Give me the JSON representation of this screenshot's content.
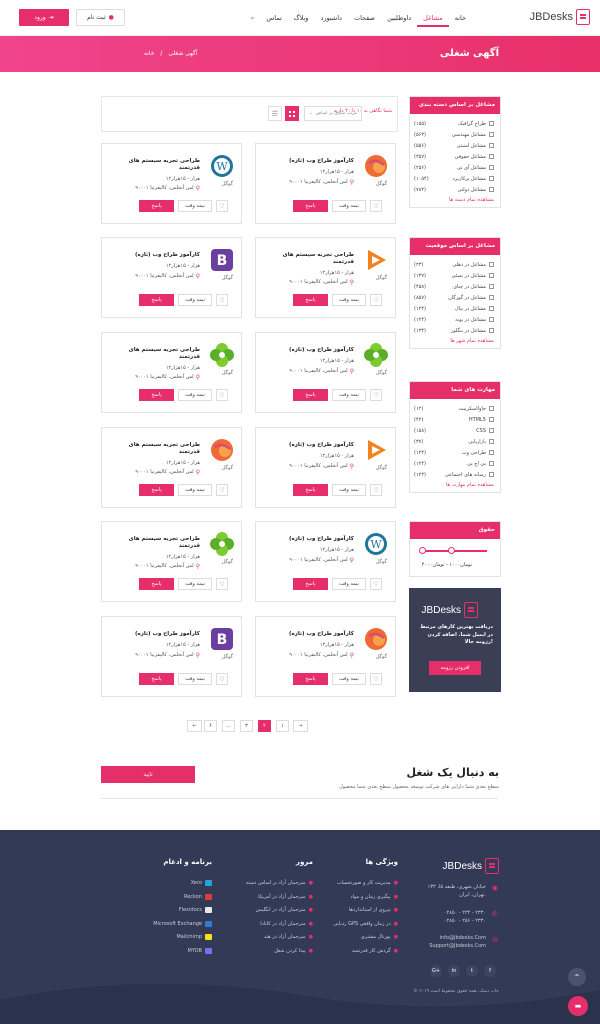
{
  "header": {
    "logo": "JBDesks",
    "nav": [
      "خانه",
      "مشاغل",
      "داوطلبین",
      "صفحات",
      "داشبورد",
      "وبلاگ",
      "تماس"
    ],
    "active_nav": "مشاغل",
    "signup": "ثبت نام",
    "login": "ورود"
  },
  "hero": {
    "title": "آگهی شغلی",
    "breadcrumb_home": "خانه",
    "breadcrumb_sep": "/",
    "breadcrumb_current": "آگهی شغلی"
  },
  "toolbar": {
    "sort_placeholder": "مرتب سازی بر اساس",
    "results": "شما نگاهی به ۱۰ تا ۲۰ دارید"
  },
  "sidebar": {
    "categories": {
      "title": "مشاغل بر اساس دسته بندی",
      "items": [
        {
          "label": "طراح گرافیک",
          "count": "(۱۵۵)"
        },
        {
          "label": "مشاغل مهندسی",
          "count": "(۵۶۳)"
        },
        {
          "label": "مشاغل امنیتی",
          "count": "(۵۵۶)"
        },
        {
          "label": "مشاغل حقوقی",
          "count": "(۳۵۷)"
        },
        {
          "label": "مشاغل آی تی",
          "count": "(۲۵۶)"
        },
        {
          "label": "مشاغل پرکاربرد",
          "count": "(۱۰۵۴)"
        },
        {
          "label": "مشاغل دولتی",
          "count": "(۷۸۴)"
        }
      ],
      "more": "مشاهده تمام دسته ها"
    },
    "locations": {
      "title": "مشاغل بر اساس موقعیت",
      "items": [
        {
          "label": "مشاغل در دهلی",
          "count": "(۲۳)"
        },
        {
          "label": "مشاغل در بمبئی",
          "count": "(۱۳۷)"
        },
        {
          "label": "مشاغل در چنای",
          "count": "(۴۵۸)"
        },
        {
          "label": "مشاغل در گورگان",
          "count": "(۸۵۷)"
        },
        {
          "label": "مشاغل در نپال",
          "count": "(۱۲۴)"
        },
        {
          "label": "مشاغل در پونه",
          "count": "(۱۲۴)"
        },
        {
          "label": "مشاغل در بنگلور",
          "count": "(۱۳۴)"
        }
      ],
      "more": "مشاهده تمام شهر ها"
    },
    "skills": {
      "title": "مهارت های شما",
      "items": [
        {
          "label": "جاوااسکریپت",
          "count": "(۱۲)"
        },
        {
          "label": "HTML5",
          "count": "(۴۲)"
        },
        {
          "label": "CSS",
          "count": "(۱۵۸)"
        },
        {
          "label": "بازاریابی",
          "count": "(۳۷)"
        },
        {
          "label": "طراحی وب",
          "count": "(۱۲۴)"
        },
        {
          "label": "بی اچ پی",
          "count": "(۱۲۴)"
        },
        {
          "label": "رسانه های اجتماعی",
          "count": "(۱۲۴)"
        }
      ],
      "more": "مشاهده تمام مهارت ها"
    },
    "salary": {
      "title": "حقوق",
      "range": "تومان۱۰۰۰ - تومان۴۰۰۰"
    },
    "promo": {
      "logo": "JBDesks",
      "text": "دریافت بهترین کارهای مرتبط در ایمیل شما. اضافه کردن رزومه حالا!",
      "button": "افزودن رزومه"
    }
  },
  "jobs": [
    {
      "title": "کارآموز طراح وب (تازه)",
      "company": "گوگل",
      "salary": "۱۲هزار - ۱۵هزار",
      "location": "لس آنجلس، کالیفرنیا ۹۰۰۰۱",
      "apply": "پاسخ",
      "type": "نیمه وقت",
      "logo": "dribbble",
      "color": "#ee6b35"
    },
    {
      "title": "طراحی تجربه سیستم های قدرتمند",
      "company": "گوگل",
      "salary": "۱۲هزار - ۱۵هزار",
      "location": "لس آنجلس، کالیفرنیا ۹۰۰۰۱",
      "apply": "پاسخ",
      "type": "نیمه وقت",
      "logo": "wordpress",
      "color": "#21759b"
    },
    {
      "title": "طراحی تجربه سیستم های قدرتمند",
      "company": "گوگل",
      "salary": "۱۲هزار - ۱۵هزار",
      "location": "لس آنجلس، کالیفرنیا ۹۰۰۰۱",
      "apply": "پاسخ",
      "type": "نیمه وقت",
      "logo": "play",
      "color": "#f3821f"
    },
    {
      "title": "کارآموز طراح وب (تازه)",
      "company": "گوگل",
      "salary": "۱۲هزار - ۱۵هزار",
      "location": "لس آنجلس، کالیفرنیا ۹۰۰۰۱",
      "apply": "پاسخ",
      "type": "نیمه وقت",
      "logo": "bootstrap",
      "color": "#6b3fa0"
    },
    {
      "title": "کارآموز طراح وب (تازه)",
      "company": "گوگل",
      "salary": "۱۲هزار - ۱۵هزار",
      "location": "لس آنجلس، کالیفرنیا ۹۰۰۰۱",
      "apply": "پاسخ",
      "type": "نیمه وقت",
      "logo": "flower",
      "color": "#7ccb2f"
    },
    {
      "title": "طراحی تجربه سیستم های قدرتمند",
      "company": "گوگل",
      "salary": "۱۲هزار - ۱۵هزار",
      "location": "لس آنجلس، کالیفرنیا ۹۰۰۰۱",
      "apply": "پاسخ",
      "type": "نیمه وقت",
      "logo": "flower",
      "color": "#7ccb2f"
    },
    {
      "title": "کارآموز طراح وب (تازه)",
      "company": "گوگل",
      "salary": "۱۲هزار - ۱۵هزار",
      "location": "لس آنجلس، کالیفرنیا ۹۰۰۰۱",
      "apply": "پاسخ",
      "type": "نیمه وقت",
      "logo": "play",
      "color": "#f3821f"
    },
    {
      "title": "طراحی تجربه سیستم های قدرتمند",
      "company": "گوگل",
      "salary": "۱۲هزار - ۱۵هزار",
      "location": "لس آنجلس، کالیفرنیا ۹۰۰۰۱",
      "apply": "پاسخ",
      "type": "نیمه وقت",
      "logo": "dribbble",
      "color": "#ee6b35"
    },
    {
      "title": "کارآموز طراح وب (تازه)",
      "company": "گوگل",
      "salary": "۱۲هزار - ۱۵هزار",
      "location": "لس آنجلس، کالیفرنیا ۹۰۰۰۱",
      "apply": "پاسخ",
      "type": "نیمه وقت",
      "logo": "wordpress",
      "color": "#21759b"
    },
    {
      "title": "طراحی تجربه سیستم های قدرتمند",
      "company": "گوگل",
      "salary": "۱۲هزار - ۱۵هزار",
      "location": "لس آنجلس، کالیفرنیا ۹۰۰۰۱",
      "apply": "پاسخ",
      "type": "نیمه وقت",
      "logo": "flower",
      "color": "#7ccb2f"
    },
    {
      "title": "کارآموز طراح وب (تازه)",
      "company": "گوگل",
      "salary": "۱۲هزار - ۱۵هزار",
      "location": "لس آنجلس، کالیفرنیا ۹۰۰۰۱",
      "apply": "پاسخ",
      "type": "نیمه وقت",
      "logo": "dribbble",
      "color": "#ee6b35"
    },
    {
      "title": "کارآموز طراح وب (تازه)",
      "company": "گوگل",
      "salary": "۱۲هزار - ۱۵هزار",
      "location": "لس آنجلس، کالیفرنیا ۹۰۰۰۱",
      "apply": "پاسخ",
      "type": "نیمه وقت",
      "logo": "bootstrap",
      "color": "#6b3fa0"
    }
  ],
  "pagination": {
    "next": "→",
    "prev": "←",
    "pages": [
      "۱",
      "۲",
      "۳",
      "...",
      "۶"
    ],
    "active": "۲"
  },
  "cta": {
    "title": "به دنبال یک شغل",
    "text": "سطح بعدی شما دارایی های شرکت توسعه محصول سطح بعدی شما محصول",
    "button": "تایید"
  },
  "footer": {
    "logo": "JBDesks",
    "address": "۱۳۳ خیابان شهری، طبقه ۵ا، تهران، ایران.",
    "phones": [
      "۰۲۸۵۰ - ۲۳۴ - ۲۳۳۰",
      "۰۲۸۵۰ - ۲۵۶ - ۲۳۳۰"
    ],
    "emails": [
      "info@Jbdesks.Com",
      "Support@Jbdesks.Com"
    ],
    "col1": {
      "title": "ویژگی ها",
      "items": [
        "مدیریت کار و صورتحساب",
        "پیگیری زمان و مواد",
        "پیروی از استانداردها",
        "ردیابی GPS در زمان واقعی",
        "پورتال مشتری",
        "گردش کار قدرتمند"
      ]
    },
    "col2": {
      "title": "مرور",
      "items": [
        "مترجمان آزاد بر اساس دسته",
        "مترجمان آزاد در آمریکا",
        "مترجمان آزاد در انگلیس",
        "مترجمان آزاد در کانادا",
        "مترجمان آزاد در هند",
        "پیدا کردن شغل"
      ]
    },
    "col3": {
      "title": "برنامه و ادغام",
      "items": [
        "Xero",
        "Reckon",
        "Flexidocs",
        "Microsoft Exchange",
        "Mailchimp",
        "MYOB"
      ]
    },
    "copyright": "© ۲۰۱۹ جاب دسک. همه حقوق محفوظ است"
  },
  "colors": {
    "accent": "#e62e6b",
    "footer_bg": "#323a55"
  }
}
